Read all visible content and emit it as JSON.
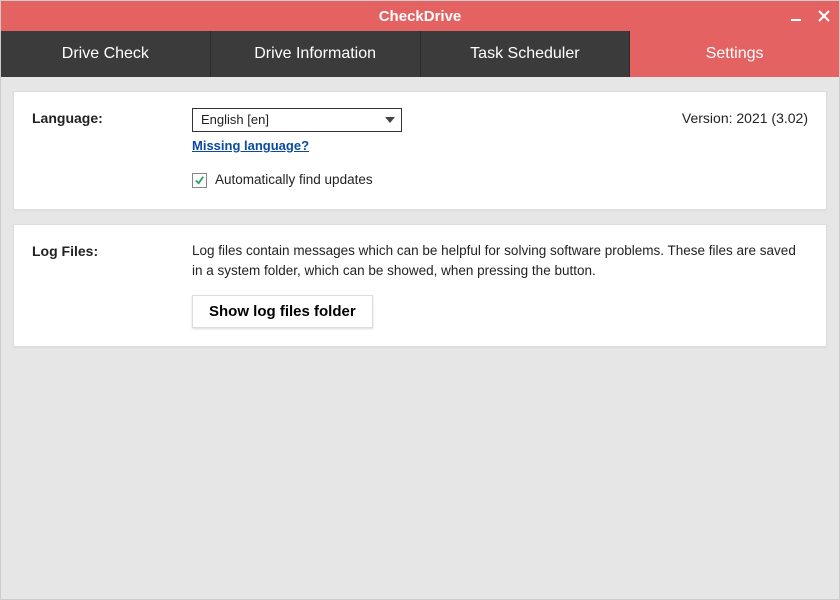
{
  "window": {
    "title": "CheckDrive"
  },
  "tabs": [
    {
      "label": "Drive Check"
    },
    {
      "label": "Drive Information"
    },
    {
      "label": "Task Scheduler"
    },
    {
      "label": "Settings"
    }
  ],
  "settings": {
    "language_label": "Language:",
    "language_value": "English [en]",
    "missing_language": "Missing language?",
    "auto_updates_label": "Automatically find updates",
    "auto_updates_checked": true,
    "version_text": "Version: 2021 (3.02)"
  },
  "logfiles": {
    "label": "Log Files:",
    "description": "Log files contain messages which can be helpful for solving software problems. These files are saved in a system folder, which can be showed, when pressing the button.",
    "button": "Show log files folder"
  }
}
